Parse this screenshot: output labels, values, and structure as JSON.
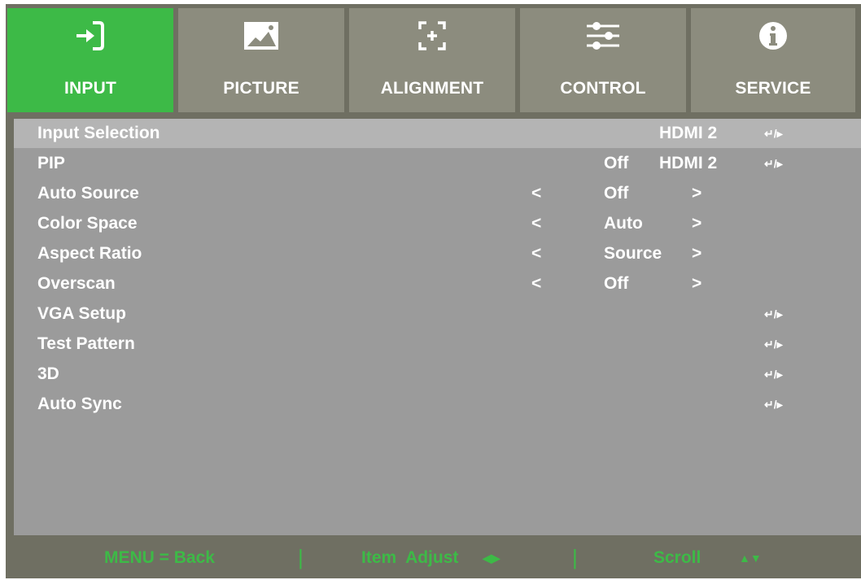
{
  "tabs": [
    {
      "label": "INPUT",
      "icon": "input-icon",
      "active": true
    },
    {
      "label": "PICTURE",
      "icon": "picture-icon",
      "active": false
    },
    {
      "label": "ALIGNMENT",
      "icon": "alignment-icon",
      "active": false
    },
    {
      "label": "CONTROL",
      "icon": "control-icon",
      "active": false
    },
    {
      "label": "SERVICE",
      "icon": "service-icon",
      "active": false
    }
  ],
  "menu": {
    "rows": [
      {
        "name": "Input Selection",
        "value": "HDMI 2",
        "enter": "↵/▸"
      },
      {
        "name": "PIP",
        "value": "Off",
        "value2": "HDMI 2",
        "enter": "↵/▸"
      },
      {
        "name": "Auto Source",
        "left": "<",
        "value": "Off",
        "right": ">"
      },
      {
        "name": "Color Space",
        "left": "<",
        "value": "Auto",
        "right": ">"
      },
      {
        "name": "Aspect Ratio",
        "left": "<",
        "value": "Source",
        "right": ">"
      },
      {
        "name": "Overscan",
        "left": "<",
        "value": "Off",
        "right": ">"
      },
      {
        "name": "VGA Setup",
        "enter": "↵/▸"
      },
      {
        "name": "Test Pattern",
        "enter": "↵/▸"
      },
      {
        "name": "3D",
        "enter": "↵/▸"
      },
      {
        "name": "Auto Sync",
        "enter": "↵/▸"
      }
    ]
  },
  "footer": {
    "back": "MENU = Back",
    "sep": "|",
    "adjust": "Item  Adjust",
    "adjust_arrows": "◀▶",
    "scroll": "Scroll",
    "scroll_arrows": "▲▼"
  },
  "colors": {
    "accent": "#3dba47",
    "tab_bg": "#8c8c7e",
    "frame": "#6f6f62",
    "panel": "#9b9b9b",
    "selected_row": "#b4b4b4"
  }
}
